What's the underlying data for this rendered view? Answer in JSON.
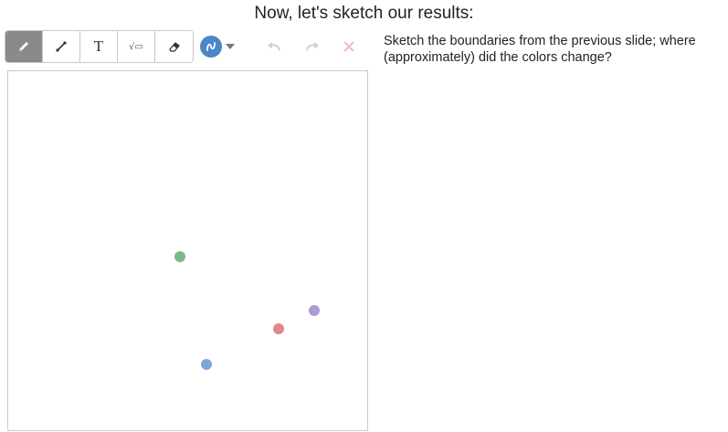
{
  "page": {
    "title": "Now, let's sketch our results:"
  },
  "instructions": "Sketch the boundaries from the previous slide; where (approximately) did the colors change?",
  "toolbar": {
    "tools": [
      {
        "name": "pencil",
        "icon": "pencil-icon",
        "active": true
      },
      {
        "name": "line",
        "icon": "line-icon",
        "active": false
      },
      {
        "name": "text",
        "icon": "text-icon",
        "glyph": "T",
        "active": false
      },
      {
        "name": "math",
        "icon": "sqrt-icon",
        "glyph": "√▭",
        "active": false
      },
      {
        "name": "eraser",
        "icon": "eraser-icon",
        "active": false
      }
    ],
    "current_color": "#4a86c8",
    "undo_enabled": false,
    "redo_enabled": false,
    "clear_enabled": false
  },
  "colors": {
    "active_tool_bg": "#8a8a8a",
    "disabled_icon": "#cfcfcf",
    "clear_disabled": "#f3b8b8"
  },
  "canvas": {
    "points": [
      {
        "color": "green",
        "hex": "#5aa86a"
      },
      {
        "color": "purple",
        "hex": "#9b7fc9"
      },
      {
        "color": "red",
        "hex": "#d86a6a"
      },
      {
        "color": "blue",
        "hex": "#5b8fd0"
      }
    ]
  }
}
